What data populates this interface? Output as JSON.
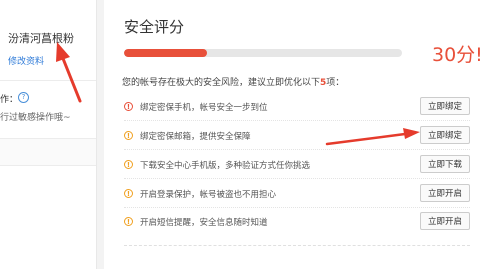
{
  "profile": {
    "username": "汾清河菖根粉",
    "edit_link": "修改资料",
    "op_label": "作：",
    "op_desc": "行过敏感操作哦~"
  },
  "security": {
    "title": "安全评分",
    "score_text": "30分!",
    "score_progress": 0.3,
    "advice_prefix": "您的帐号存在极大的安全风险，建议立即优化以下",
    "advice_count": "5",
    "advice_suffix": "项：",
    "items": [
      {
        "icon": "alert-red-icon",
        "text": "绑定密保手机，帐号安全一步到位",
        "button": "立即绑定"
      },
      {
        "icon": "alert-orange-icon",
        "text": "绑定密保邮箱，提供安全保障",
        "button": "立即绑定"
      },
      {
        "icon": "alert-orange-icon",
        "text": "下载安全中心手机版，多种验证方式任你挑选",
        "button": "立即下载"
      },
      {
        "icon": "alert-orange-icon",
        "text": "开启登录保护，帐号被盗也不用担心",
        "button": "立即开启"
      },
      {
        "icon": "alert-orange-icon",
        "text": "开启短信提醒，安全信息随时知道",
        "button": "立即开启"
      }
    ]
  },
  "colors": {
    "accent": "#e8503a",
    "warning": "#f0a020",
    "link": "#2f7bd8"
  }
}
